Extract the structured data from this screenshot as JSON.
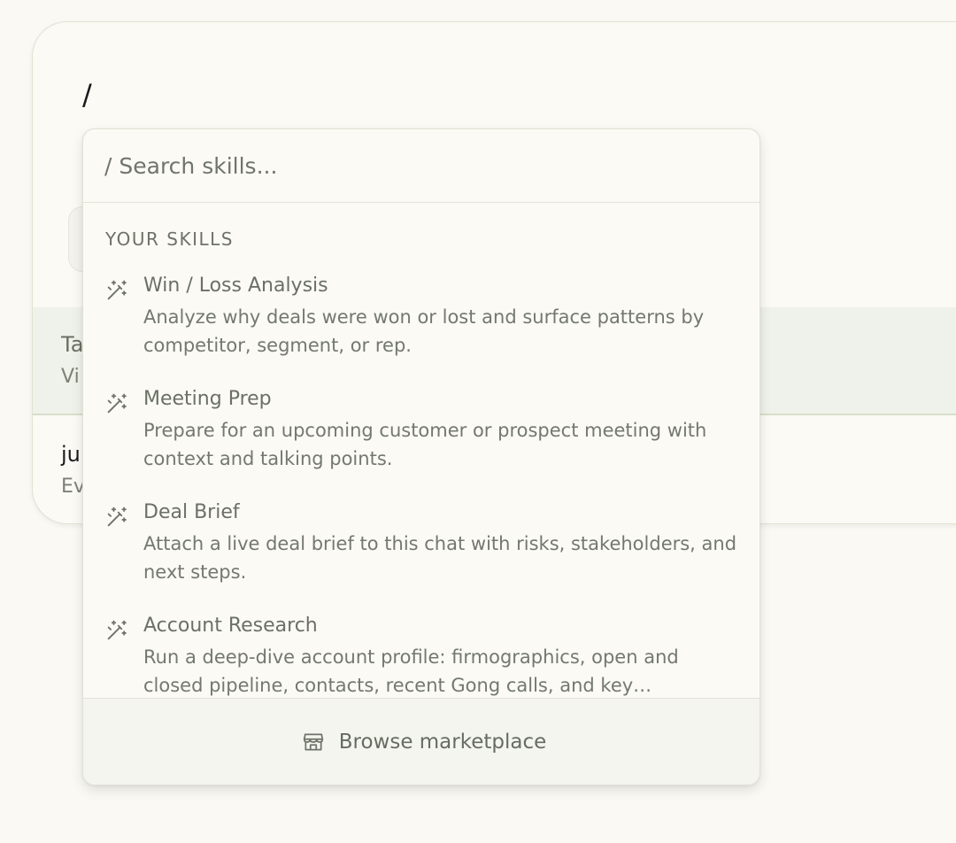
{
  "composer": {
    "input_text": "/",
    "rows": [
      {
        "title": "Ta",
        "subtitle": "Vi"
      },
      {
        "title": "ju",
        "subtitle": "Ev"
      }
    ]
  },
  "dropdown": {
    "search": {
      "placeholder": "/ Search skills..."
    },
    "section_label": "YOUR SKILLS",
    "skills": [
      {
        "icon": "magic-wand-icon",
        "title": "Win / Loss Analysis",
        "description": "Analyze why deals were won or lost and surface patterns by competitor, segment, or rep."
      },
      {
        "icon": "magic-wand-icon",
        "title": "Meeting Prep",
        "description": "Prepare for an upcoming customer or prospect meeting with context and talking points."
      },
      {
        "icon": "magic-wand-icon",
        "title": "Deal Brief",
        "description": "Attach a live deal brief to this chat with risks, stakeholders, and next steps."
      },
      {
        "icon": "magic-wand-icon",
        "title": "Account Research",
        "description": "Run a deep-dive account profile: firmographics, open and closed pipeline, contacts, recent Gong calls, and key…"
      }
    ],
    "footer": {
      "icon": "storefront-icon",
      "label": "Browse marketplace"
    }
  },
  "colors": {
    "background": "#faf9f4",
    "highlight_row": "#eff2ea",
    "text_muted": "#6b7066"
  }
}
